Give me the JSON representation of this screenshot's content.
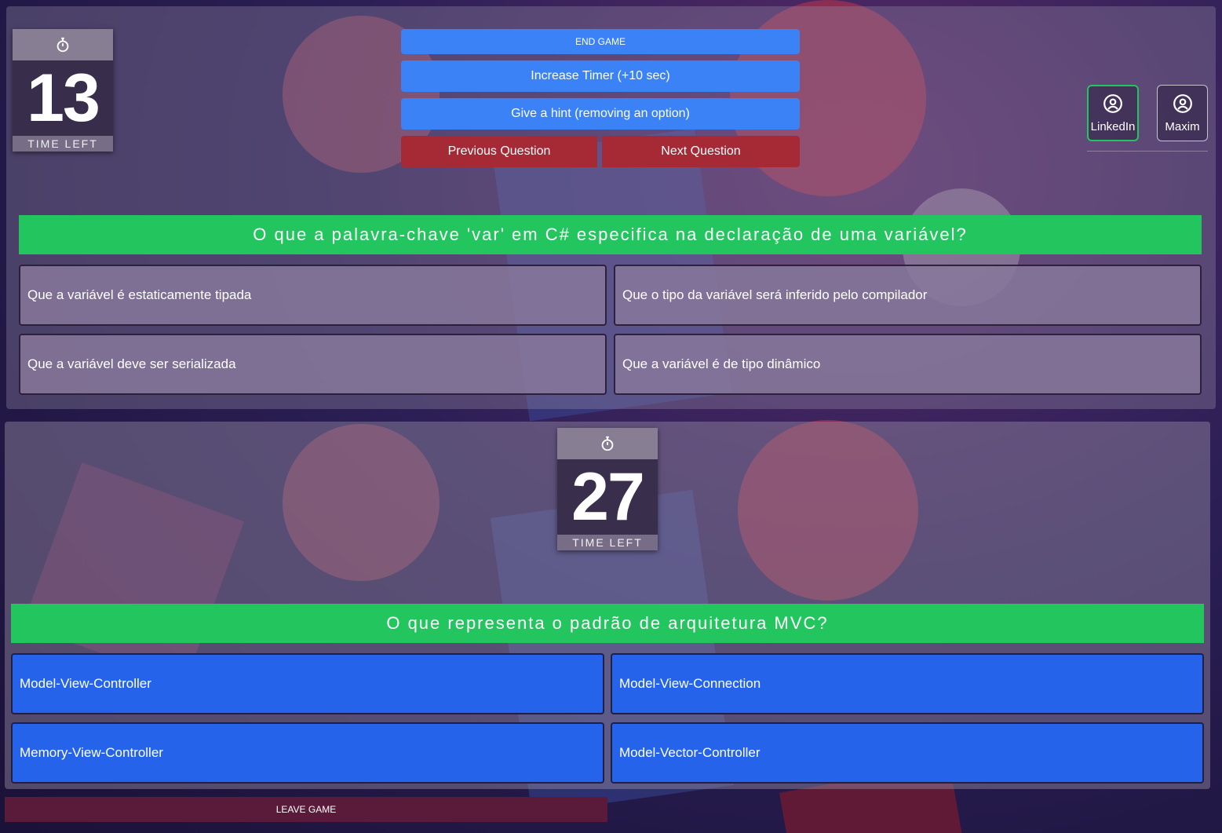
{
  "top_game": {
    "timer": {
      "value": "13",
      "label": "TIME LEFT"
    },
    "controls": {
      "end_game": "END GAME",
      "increase_timer": "Increase Timer (+10 sec)",
      "hint": "Give a hint (removing an option)",
      "previous": "Previous Question",
      "next": "Next Question"
    },
    "question": "O que a palavra-chave 'var' em C# especifica na declaração de uma variável?",
    "answers": [
      "Que a variável é estaticamente tipada",
      "Que o tipo da variável será inferido pelo compilador",
      "Que a variável deve ser serializada",
      "Que a variável é de tipo dinâmico"
    ]
  },
  "social": {
    "linkedin": "LinkedIn",
    "maxim": "Maxim"
  },
  "bottom_game": {
    "timer": {
      "value": "27",
      "label": "TIME LEFT"
    },
    "question": "O que representa o padrão de arquitetura MVC?",
    "answers": [
      "Model-View-Controller",
      "Model-View-Connection",
      "Memory-View-Controller",
      "Model-Vector-Controller"
    ],
    "leave_game": "LEAVE GAME"
  },
  "icons": [
    "stopwatch-icon",
    "user-circle-icon"
  ],
  "colors": {
    "green": "#22c55e",
    "blue": "#3b82f6",
    "answer_blue": "#2563eb",
    "red": "#a52a36"
  }
}
